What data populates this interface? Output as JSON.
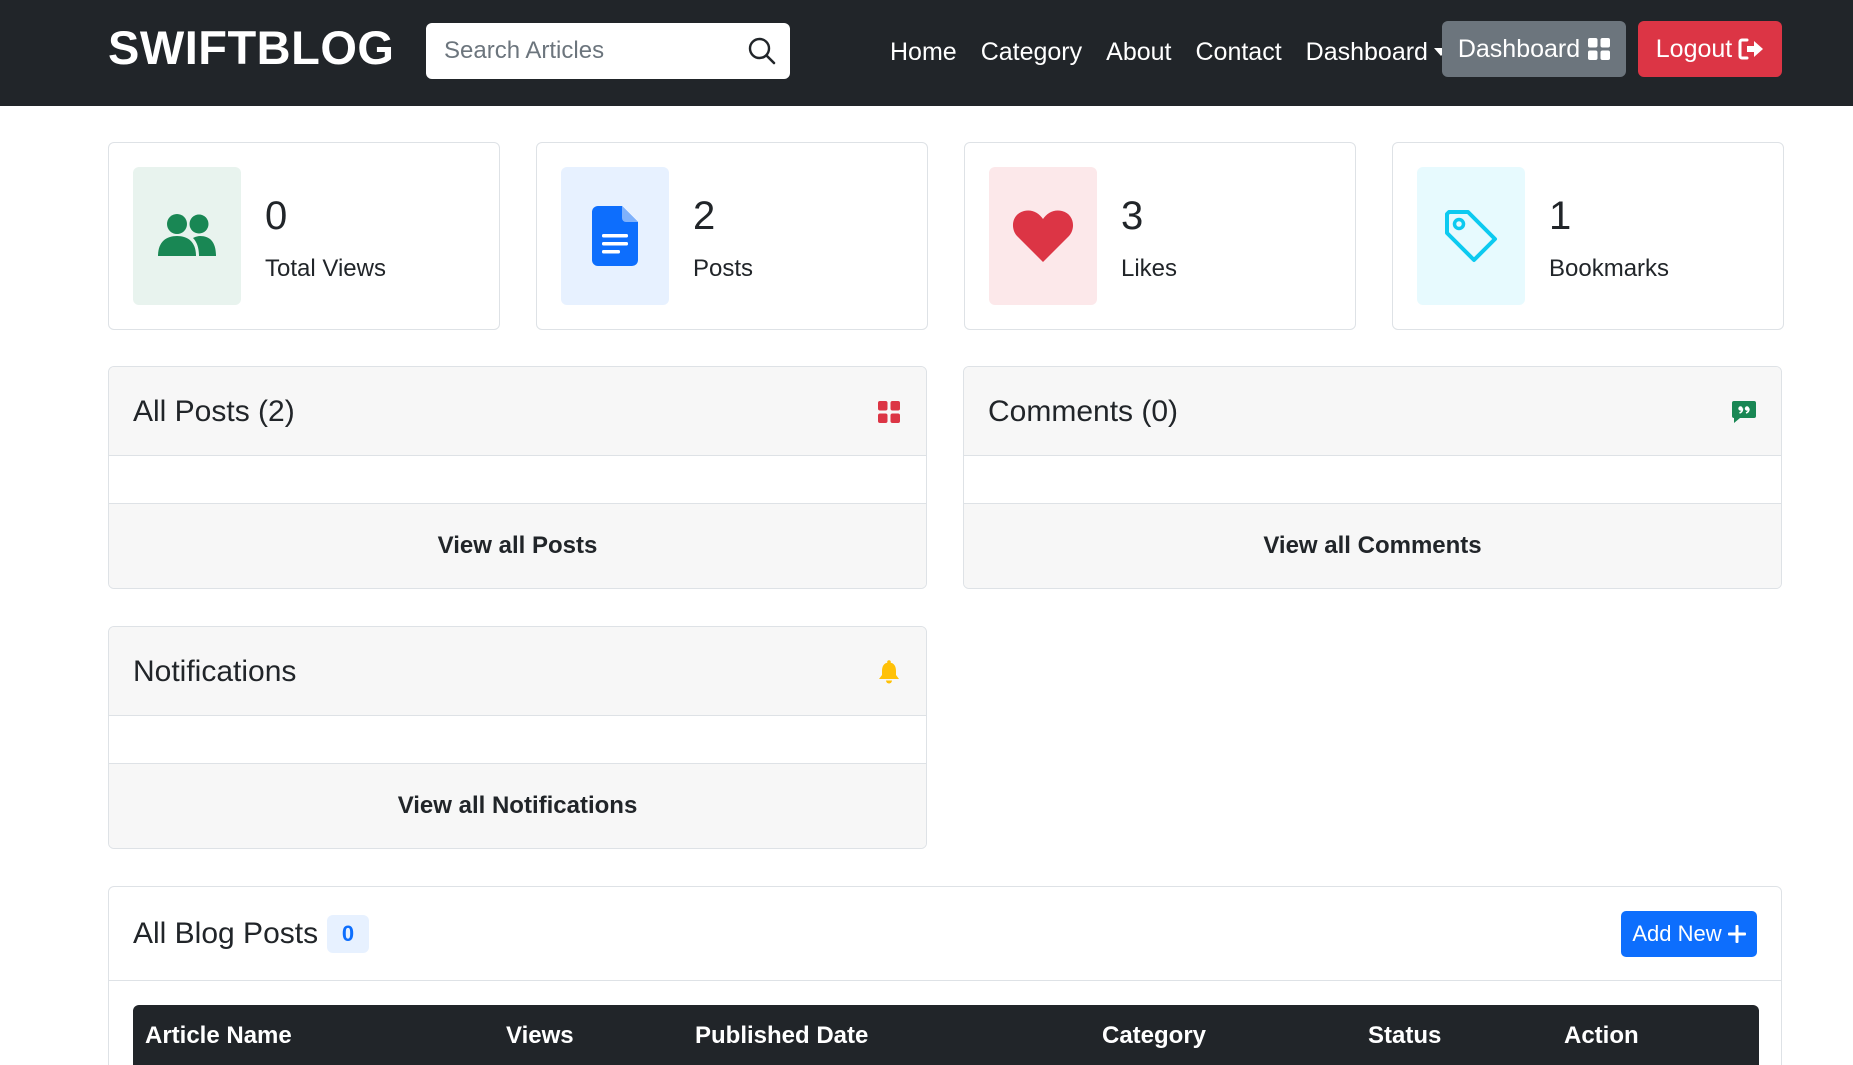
{
  "brand": "SWIFTBLOG",
  "search": {
    "placeholder": "Search Articles",
    "value": ""
  },
  "nav": {
    "links": [
      "Home",
      "Category",
      "About",
      "Contact"
    ],
    "dropdown_label": "Dashboard",
    "dashboard_button": "Dashboard",
    "logout_button": "Logout"
  },
  "stats": [
    {
      "value": "0",
      "label": "Total Views",
      "icon": "users-icon",
      "color": "#198754",
      "bg": "#e8f3ee"
    },
    {
      "value": "2",
      "label": "Posts",
      "icon": "document-icon",
      "color": "#0d6efd",
      "bg": "#e7f1ff"
    },
    {
      "value": "3",
      "label": "Likes",
      "icon": "heart-icon",
      "color": "#dc3545",
      "bg": "#fce8ea"
    },
    {
      "value": "1",
      "label": "Bookmarks",
      "icon": "tag-icon",
      "color": "#0dcaf0",
      "bg": "#e7fafe"
    }
  ],
  "panels": {
    "posts": {
      "title": "All Posts (2)",
      "footer": "View all Posts",
      "icon": "grid-icon",
      "color": "#dc3545"
    },
    "comments": {
      "title": "Comments (0)",
      "footer": "View all Comments",
      "icon": "quote-comment-icon",
      "color": "#198754"
    },
    "notifications": {
      "title": "Notifications",
      "footer": "View all Notifications",
      "icon": "bell-icon",
      "color": "#ffc107"
    }
  },
  "blog_posts": {
    "title": "All Blog Posts",
    "count": "0",
    "add_button": "Add New",
    "columns": [
      "Article Name",
      "Views",
      "Published Date",
      "Category",
      "Status",
      "Action"
    ]
  }
}
